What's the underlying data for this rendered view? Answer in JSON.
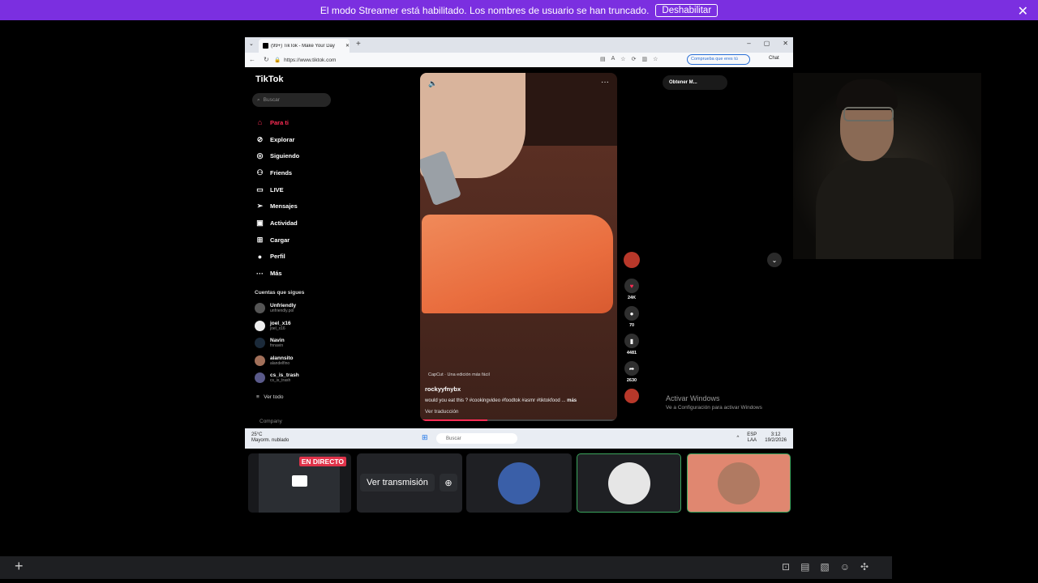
{
  "banner": {
    "text": "El modo Streamer está habilitado. Los nombres de usuario se han truncado.",
    "button": "Deshabilitar"
  },
  "browser": {
    "tab_title": "(99+) TikTok - Make Your Day",
    "url": "https://www.tiktok.com",
    "comprueba": "Comprueba que eres tú",
    "chat": "Chat"
  },
  "tiktok": {
    "logo": "TikTok",
    "search_placeholder": "Buscar",
    "menu": [
      {
        "label": "Para ti",
        "icon": "home-icon"
      },
      {
        "label": "Explorar",
        "icon": "compass-icon"
      },
      {
        "label": "Siguiendo",
        "icon": "following-icon"
      },
      {
        "label": "Friends",
        "icon": "friends-icon"
      },
      {
        "label": "LIVE",
        "icon": "live-icon"
      },
      {
        "label": "Mensajes",
        "icon": "messages-icon"
      },
      {
        "label": "Actividad",
        "icon": "activity-icon"
      },
      {
        "label": "Cargar",
        "icon": "upload-icon"
      },
      {
        "label": "Perfil",
        "icon": "profile-icon"
      },
      {
        "label": "Más",
        "icon": "more-icon"
      }
    ],
    "following_title": "Cuentas que sigues",
    "accounts": [
      {
        "name": "Unfriendly",
        "handle": "unfriendly.pol"
      },
      {
        "name": "joel_x16",
        "handle": "joel_x16"
      },
      {
        "name": "Navin",
        "handle": "fnnavin"
      },
      {
        "name": "alannsito",
        "handle": "alandelfino"
      },
      {
        "name": "cs_is_trash",
        "handle": "cs_is_trash"
      }
    ],
    "ver_todo": "Ver todo",
    "company": "Company",
    "video": {
      "capcut": "CapCut · Una edición más fácil",
      "user": "rockyyfnybx",
      "desc": "would you eat this ? #cookingvideo #foodtok #asmr #tiktokfood ...",
      "more": "más",
      "translate": "Ver traducción",
      "progress": 0.34
    },
    "counts": {
      "likes": "24K",
      "comments": "70",
      "saves": "4481",
      "shares": "2630"
    },
    "obtener": "Obtener M..."
  },
  "windows": {
    "activate_title": "Activar Windows",
    "activate_sub": "Ve a Configuración para activar Windows",
    "weather_temp": "25°C",
    "weather_desc": "Mayorm. nublado",
    "search": "Buscar",
    "lang1": "ESP",
    "lang2": "LAA",
    "time": "3:12",
    "date": "19/2/2026"
  },
  "participants": {
    "live_badge": "EN DIRECTO",
    "watch": "Ver transmisión"
  }
}
